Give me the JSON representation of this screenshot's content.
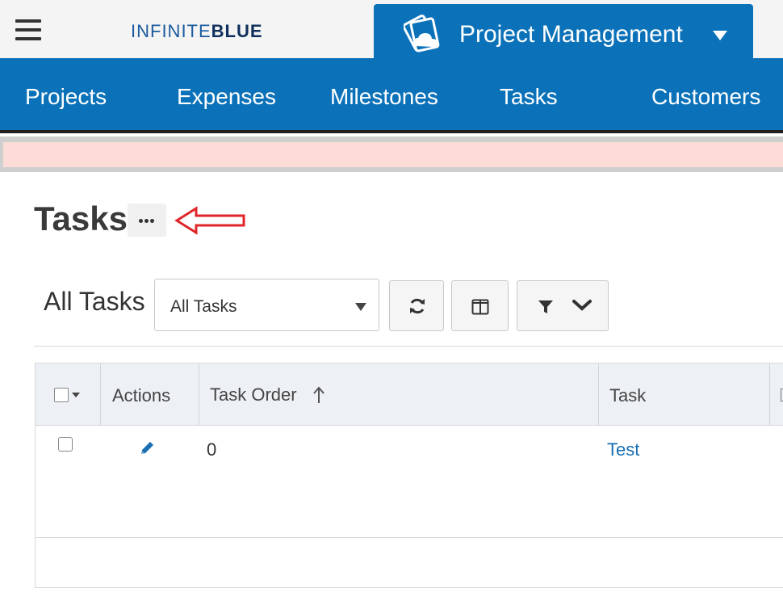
{
  "header": {
    "logo_light": "INFINITE",
    "logo_bold": "BLUE",
    "app_title": "Project Management"
  },
  "nav": {
    "items": [
      "Projects",
      "Expenses",
      "Milestones",
      "Tasks",
      "Customers"
    ]
  },
  "page": {
    "title": "Tasks"
  },
  "toolbar": {
    "view_label": "All Tasks",
    "view_select_value": "All Tasks"
  },
  "table": {
    "headers": [
      "Actions",
      "Task Order",
      "Task"
    ],
    "rows": [
      {
        "task_order": "0",
        "task": "Test"
      }
    ]
  },
  "colors": {
    "brand_blue": "#0b72b9",
    "alert_bg": "#fddcd8",
    "annotation_arrow": "#e0262b",
    "link": "#1a6fb3"
  }
}
